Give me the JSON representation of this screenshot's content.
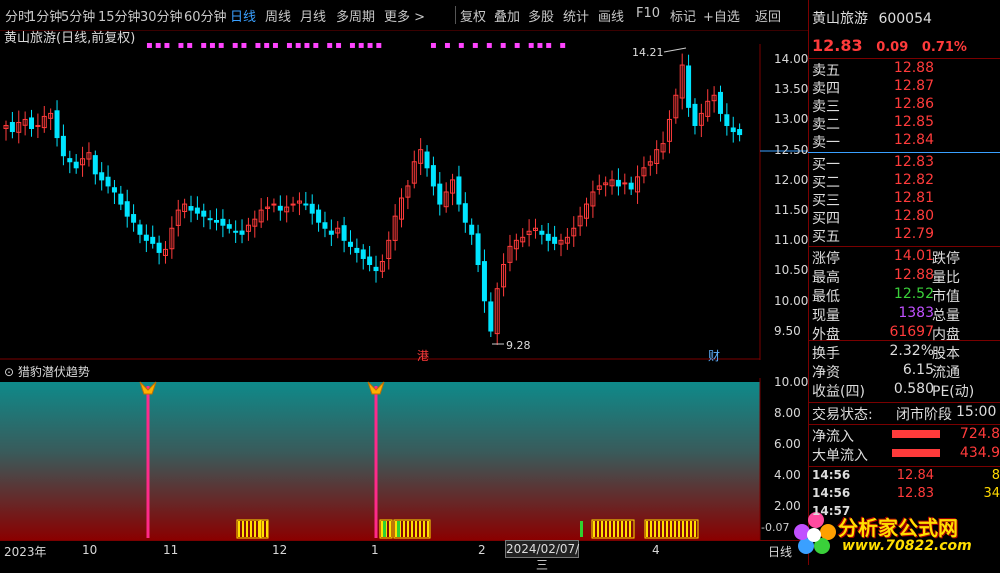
{
  "toolbar": {
    "periods": [
      "分时",
      "1分钟",
      "5分钟",
      "15分钟",
      "30分钟",
      "60分钟",
      "日线",
      "周线",
      "月线",
      "多周期",
      "更多 >"
    ],
    "tools": [
      "复权",
      "叠加",
      "多股",
      "统计",
      "画线",
      "F10",
      "标记",
      "+自选",
      "返回"
    ]
  },
  "main_chart": {
    "title": "黄山旅游",
    "subtitle": "(日线,前复权)",
    "high_label": "14.21",
    "low_label": "9.28",
    "port_tag": "港",
    "fin_tag": "财",
    "y_ticks": [
      "14.00",
      "13.50",
      "13.00",
      "12.50",
      "12.00",
      "11.50",
      "11.00",
      "10.50",
      "10.00",
      "9.50"
    ]
  },
  "indicator": {
    "title": "猎豹潜伏趋势",
    "y_ticks": [
      "10.00",
      "8.00",
      "6.00",
      "4.00",
      "2.00"
    ],
    "bottom_value": "-0.07"
  },
  "time_axis": {
    "labels": [
      "2023年",
      "10",
      "11",
      "12",
      "1",
      "2",
      "4"
    ],
    "cursor_date": "2024/02/07/三",
    "right_label": "日线"
  },
  "quote": {
    "name": "黄山旅游",
    "code": "600054",
    "price": "12.83",
    "change": "0.09",
    "change_pct": "0.71%",
    "asks": [
      {
        "label": "卖五",
        "price": "12.88"
      },
      {
        "label": "卖四",
        "price": "12.87"
      },
      {
        "label": "卖三",
        "price": "12.86"
      },
      {
        "label": "卖二",
        "price": "12.85"
      },
      {
        "label": "卖一",
        "price": "12.84"
      }
    ],
    "bids": [
      {
        "label": "买一",
        "price": "12.83"
      },
      {
        "label": "买二",
        "price": "12.82"
      },
      {
        "label": "买三",
        "price": "12.81"
      },
      {
        "label": "买四",
        "price": "12.80"
      },
      {
        "label": "买五",
        "price": "12.79"
      }
    ],
    "stats": [
      {
        "label": "涨停",
        "value": "14.01",
        "label2": "跌停"
      },
      {
        "label": "最高",
        "value": "12.88",
        "label2": "量比"
      },
      {
        "label": "最低",
        "value": "12.52",
        "label2": "市值"
      },
      {
        "label": "现量",
        "value": "1383",
        "label2": "总量"
      },
      {
        "label": "外盘",
        "value": "61697",
        "label2": "内盘"
      }
    ],
    "stats2": [
      {
        "label": "换手",
        "value": "2.32%",
        "label2": "股本"
      },
      {
        "label": "净资",
        "value": "6.15",
        "label2": "流通"
      },
      {
        "label": "收益(四)",
        "value": "0.580",
        "label2": "PE(动)"
      }
    ],
    "trade_status_label": "交易状态:",
    "trade_status": "闭市阶段",
    "trade_time": "15:00",
    "net_inflow_label": "净流入",
    "net_inflow": "724.8",
    "big_inflow_label": "大单流入",
    "big_inflow": "434.9",
    "ticks": [
      {
        "time": "14:56",
        "price": "12.84",
        "vol": "8"
      },
      {
        "time": "14:56",
        "price": "12.83",
        "vol": "34"
      },
      {
        "time": "14:57",
        "price": "",
        "vol": ""
      }
    ]
  },
  "watermark": {
    "brand": "分析家公式网",
    "url": "www.70822.com"
  },
  "colors": {
    "up": "#ff3b3b",
    "down": "#00e5ff",
    "active_tab": "#3aa0ff",
    "price_yellow": "#ffd800",
    "signal_pink": "#ff2a8a"
  }
}
